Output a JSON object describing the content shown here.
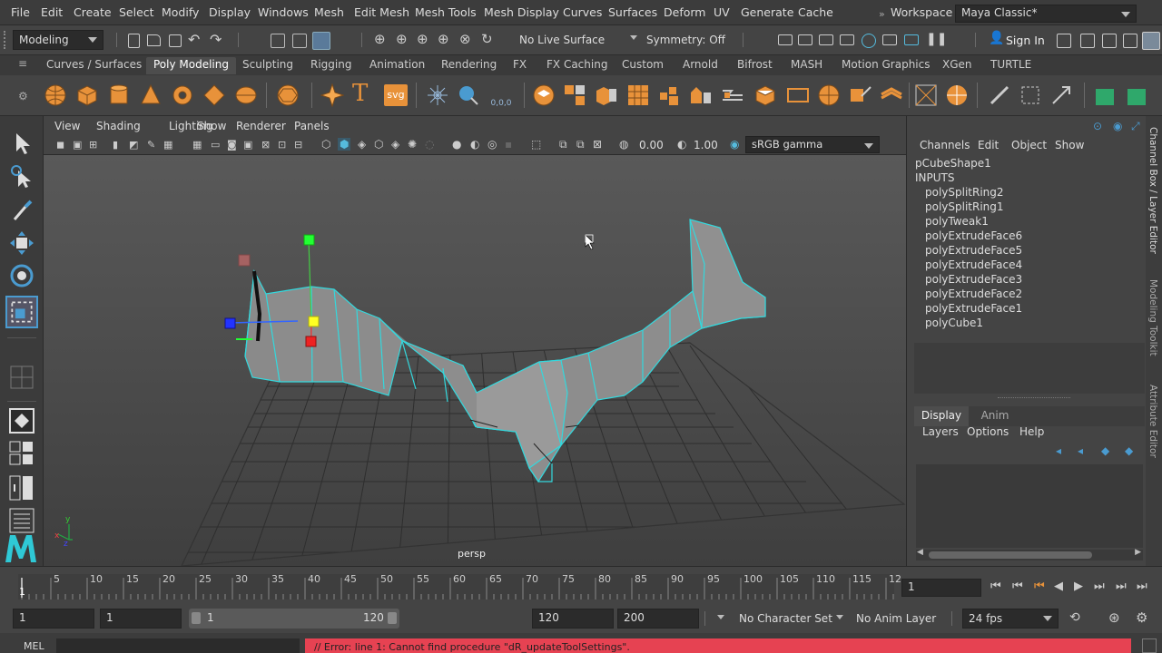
{
  "menubar": {
    "items": [
      "File",
      "Edit",
      "Create",
      "Select",
      "Modify",
      "Display",
      "Windows",
      "Mesh",
      "Edit Mesh",
      "Mesh Tools",
      "Mesh Display",
      "Curves",
      "Surfaces",
      "Deform",
      "UV",
      "Generate",
      "Cache"
    ],
    "workspace_label": "Workspace :",
    "workspace_value": "Maya Classic*"
  },
  "statusline": {
    "mode": "Modeling",
    "live_surface": "No Live Surface",
    "symmetry": "Symmetry: Off",
    "sign_in": "Sign In"
  },
  "shelf": {
    "tabs": [
      "Curves / Surfaces",
      "Poly Modeling",
      "Sculpting",
      "Rigging",
      "Animation",
      "Rendering",
      "FX",
      "FX Caching",
      "Custom",
      "Arnold",
      "Bifrost",
      "MASH",
      "Motion Graphics",
      "XGen",
      "TURTLE"
    ],
    "active_tab": "Poly Modeling",
    "text_icon": "T",
    "svg_icon": "svg",
    "bonus_icon": "0,0,0"
  },
  "viewport": {
    "menus": [
      "View",
      "Shading",
      "Lighting",
      "Show",
      "Renderer",
      "Panels"
    ],
    "exposure": "0.00",
    "gamma": "1.00",
    "colorspace": "sRGB gamma",
    "camera_label": "persp"
  },
  "channelbox": {
    "menus": [
      "Channels",
      "Edit",
      "Object",
      "Show"
    ],
    "shape": "pCubeShape1",
    "inputs_label": "INPUTS",
    "inputs": [
      "polySplitRing2",
      "polySplitRing1",
      "polyTweak1",
      "polyExtrudeFace6",
      "polyExtrudeFace5",
      "polyExtrudeFace4",
      "polyExtrudeFace3",
      "polyExtrudeFace2",
      "polyExtrudeFace1",
      "polyCube1"
    ]
  },
  "layereditor": {
    "tabs": [
      "Display",
      "Anim"
    ],
    "menus": [
      "Layers",
      "Options",
      "Help"
    ]
  },
  "side_tabs": [
    "Channel Box / Layer Editor",
    "Modeling Toolkit",
    "Attribute Editor"
  ],
  "timeline": {
    "ticks": [
      "5",
      "10",
      "15",
      "20",
      "25",
      "30",
      "35",
      "40",
      "45",
      "50",
      "55",
      "60",
      "65",
      "70",
      "75",
      "80",
      "85",
      "90",
      "95",
      "100",
      "105",
      "110",
      "115",
      "12"
    ],
    "start_frame": "1",
    "current_frame": "1"
  },
  "range": {
    "start": "1",
    "anim_start": "1",
    "range_start": "1",
    "range_end": "120",
    "end": "120",
    "anim_end": "200",
    "character_set": "No Character Set",
    "anim_layer": "No Anim Layer",
    "fps": "24 fps"
  },
  "cmdline": {
    "lang": "MEL",
    "error": "// Error: line 1: Cannot find procedure \"dR_updateToolSettings\"."
  }
}
